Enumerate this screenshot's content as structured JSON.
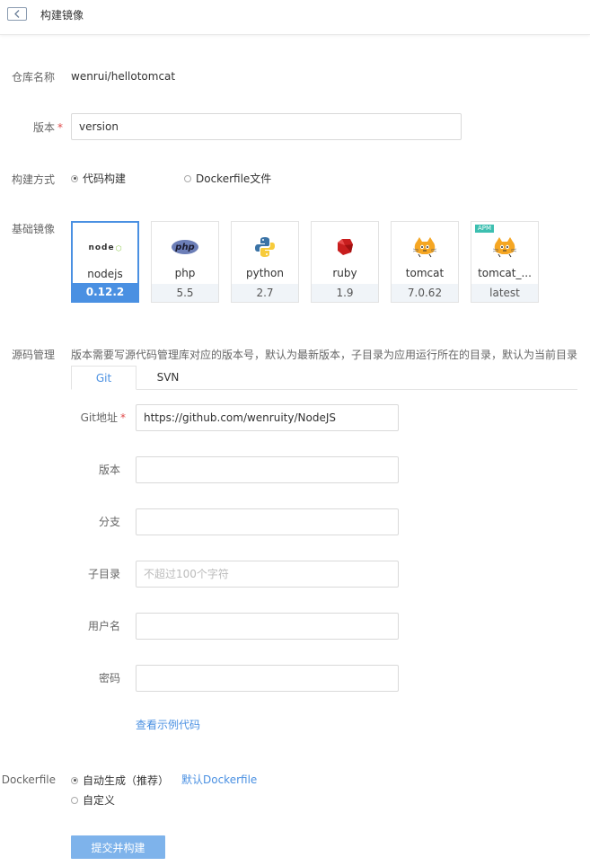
{
  "header": {
    "title": "构建镜像"
  },
  "repo": {
    "label": "仓库名称",
    "value": "wenrui/hellotomcat"
  },
  "version": {
    "label": "版本",
    "value": "version"
  },
  "build_method": {
    "label": "构建方式",
    "options": [
      {
        "label": "代码构建",
        "selected": true
      },
      {
        "label": "Dockerfile文件",
        "selected": false
      }
    ]
  },
  "base_image": {
    "label": "基础镜像",
    "cards": [
      {
        "name": "nodejs",
        "version": "0.12.2",
        "icon": "nodejs-logo",
        "logo_text": "node",
        "selected": true
      },
      {
        "name": "php",
        "version": "5.5",
        "icon": "php-logo",
        "logo_text": "php"
      },
      {
        "name": "python",
        "version": "2.7",
        "icon": "python-logo"
      },
      {
        "name": "ruby",
        "version": "1.9",
        "icon": "ruby-logo"
      },
      {
        "name": "tomcat",
        "version": "7.0.62",
        "icon": "tomcat-logo"
      },
      {
        "name": "tomcat_...",
        "version": "latest",
        "icon": "tomcat-logo",
        "badge": "APM"
      }
    ]
  },
  "source": {
    "label": "源码管理",
    "hint": "版本需要写源代码管理库对应的版本号，默认为最新版本，子目录为应用运行所在的目录，默认为当前目录",
    "tabs": [
      {
        "label": "Git",
        "active": true
      },
      {
        "label": "SVN",
        "active": false
      }
    ],
    "fields": {
      "git_url": {
        "label": "Git地址",
        "value": "https://github.com/wenruity/NodeJS",
        "required": true
      },
      "version": {
        "label": "版本",
        "value": ""
      },
      "branch": {
        "label": "分支",
        "value": ""
      },
      "subdir": {
        "label": "子目录",
        "value": "",
        "placeholder": "不超过100个字符"
      },
      "username": {
        "label": "用户名",
        "value": ""
      },
      "password": {
        "label": "密码",
        "value": ""
      }
    },
    "sample_link": "查看示例代码"
  },
  "dockerfile": {
    "label": "Dockerfile",
    "options": [
      {
        "label": "自动生成（推荐）",
        "selected": true
      },
      {
        "label": "自定义",
        "selected": false
      }
    ],
    "default_link": "默认Dockerfile"
  },
  "submit_label": "提交并构建",
  "colors": {
    "accent": "#4a90e2",
    "required": "#e04b4b",
    "submit": "#7eb3eb",
    "apm_badge": "#3dbfb0"
  }
}
